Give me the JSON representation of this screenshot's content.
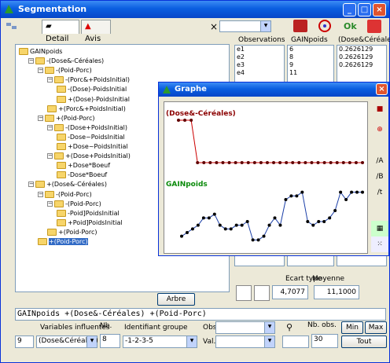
{
  "window": {
    "title": "Segmentation"
  },
  "tabs": [
    "Detail",
    "Avis"
  ],
  "toolbar": {
    "close_x": "×",
    "ok": "Ok"
  },
  "tree": [
    {
      "label": "GAINpoids",
      "level": 0,
      "sign": ""
    },
    {
      "label": "-(Dose&-Céréales)",
      "level": 1,
      "sign": "-"
    },
    {
      "label": "-(Poid-Porc)",
      "level": 2,
      "sign": "-"
    },
    {
      "label": "-(Porc&+PoidsInitial)",
      "level": 3,
      "sign": "-"
    },
    {
      "label": "-(Dose)-PoidsInitial",
      "level": 4,
      "sign": ""
    },
    {
      "label": "+(Dose)-PoidsInitial",
      "level": 4,
      "sign": ""
    },
    {
      "label": "+(Porc&+PoidsInitial)",
      "level": 3,
      "sign": ""
    },
    {
      "label": "+(Poid-Porc)",
      "level": 2,
      "sign": "-"
    },
    {
      "label": "-(Dose+PoidsInitial)",
      "level": 3,
      "sign": "-"
    },
    {
      "label": "-Dose~PoidsInitial",
      "level": 4,
      "sign": ""
    },
    {
      "label": "+Dose~PoidsInitial",
      "level": 4,
      "sign": ""
    },
    {
      "label": "+(Dose+PoidsInitial)",
      "level": 3,
      "sign": "-"
    },
    {
      "label": "+Dose*Boeuf",
      "level": 4,
      "sign": ""
    },
    {
      "label": "-Dose*Boeuf",
      "level": 4,
      "sign": ""
    },
    {
      "label": "+(Dose&-Céréales)",
      "level": 1,
      "sign": "-"
    },
    {
      "label": "-(Poid-Porc)",
      "level": 2,
      "sign": "-"
    },
    {
      "label": "-(Poid-Porc)",
      "level": 3,
      "sign": "-"
    },
    {
      "label": "-Poid]PoidsInitial",
      "level": 4,
      "sign": ""
    },
    {
      "label": "+Poid]PoidsInitial",
      "level": 4,
      "sign": ""
    },
    {
      "label": "+(Poid-Porc)",
      "level": 3,
      "sign": ""
    },
    {
      "label": "+(Poid-Porc)",
      "level": 2,
      "sign": "",
      "selected": true
    }
  ],
  "columns": {
    "observations": {
      "header": "Observations",
      "values": [
        "e1",
        "e2",
        "e3",
        "e4"
      ]
    },
    "gainpoids": {
      "header": "GAINpoids",
      "values": [
        "6",
        "8",
        "9",
        "11"
      ]
    },
    "dose": {
      "header": "(Dose&Céréales)",
      "values": [
        "0.2626129",
        "0.2626129",
        "0.2626129"
      ]
    }
  },
  "graph": {
    "title": "Graphe",
    "top_label": "(Dose&-Céréales)",
    "bottom_label": "GAINpoids"
  },
  "stats": {
    "ecart_label": "Ecart type",
    "ecart_value": "4,7077",
    "moyenne_label": "Moyenne",
    "moyenne_value": "11,1000"
  },
  "arbre_button": "Arbre",
  "formula": "GAINpoids +(Dose&-Céréales) +(Poid-Porc)",
  "bottom": {
    "variables_label": "Variables influentes",
    "nb_label": "Nb.",
    "identifiant_label": "Identifiant groupe",
    "obs_label": "Obs.",
    "val_label": "Val.",
    "nbobs_label": "Nb. obs.",
    "count": "9",
    "variable_value": "(Dose&Céréales)",
    "nb_value": "8",
    "groupe_value": "-1-2-3-5",
    "nbobs_value": "30",
    "min_button": "Min",
    "max_button": "Max",
    "tout_button": "Tout"
  },
  "chart_data": {
    "type": "line",
    "series": [
      {
        "name": "(Dose&-Céréales)",
        "values": [
          0.95,
          0.95,
          0.95,
          0.05,
          0.05,
          0.05,
          0.05,
          0.05,
          0.05,
          0.05,
          0.05,
          0.05,
          0.05,
          0.05,
          0.05,
          0.05,
          0.05,
          0.05,
          0.05,
          0.05,
          0.05,
          0.05,
          0.05,
          0.05,
          0.05,
          0.05,
          0.05,
          0.05,
          0.05,
          0.05
        ]
      },
      {
        "name": "GAINpoids",
        "values": [
          6,
          7,
          8,
          9,
          11,
          11,
          12,
          9,
          8,
          8,
          9,
          9,
          10,
          5,
          5,
          6,
          9,
          11,
          9,
          16,
          17,
          17,
          18,
          10,
          9,
          10,
          10,
          11,
          13,
          18,
          16,
          18,
          18,
          18
        ]
      }
    ]
  }
}
